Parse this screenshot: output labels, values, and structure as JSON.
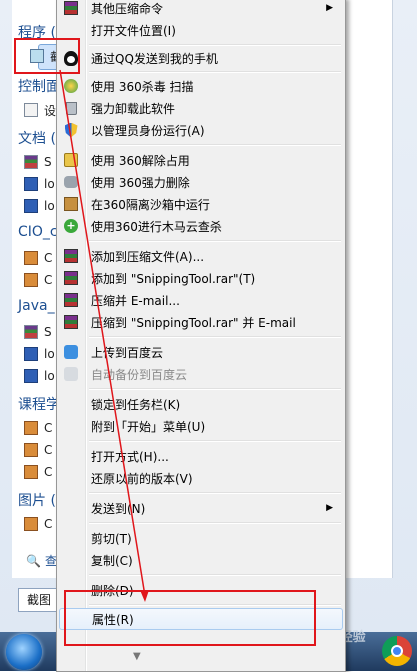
{
  "start_menu": {
    "groups": [
      {
        "label": "程序 ("
      },
      {
        "label": "控制面"
      },
      {
        "label": "文档 ("
      },
      {
        "label": "CIO_c"
      },
      {
        "label": "Java_"
      },
      {
        "label": "课程学"
      },
      {
        "label": "图片 ("
      }
    ],
    "items": {
      "program_1": "截",
      "control_1": "设",
      "doc_1": "S",
      "doc_2": "lo",
      "doc_3": "lo",
      "cio_1": "C",
      "cio_2": "C",
      "java_1": "S",
      "java_2": "lo",
      "java_3": "lo",
      "course_1": "C",
      "course_2": "C",
      "course_3": "C",
      "pic_1": "C"
    },
    "see_more": "查看",
    "search_value": "截图"
  },
  "context_menu": {
    "items": [
      {
        "label": "其他压缩命令",
        "submenu": true,
        "icon": "rar-icon"
      },
      {
        "label": "打开文件位置(I)"
      },
      {
        "label": "通过QQ发送到我的手机",
        "icon": "qq-icon"
      },
      {
        "label": "使用 360杀毒 扫描",
        "icon": "360-antivirus-icon"
      },
      {
        "label": "强力卸载此软件",
        "icon": "trash-icon"
      },
      {
        "label": "以管理员身份运行(A)",
        "icon": "uac-shield-icon"
      },
      {
        "label": "使用 360解除占用",
        "icon": "unlock-icon"
      },
      {
        "label": "使用 360强力删除",
        "icon": "shred-icon"
      },
      {
        "label": "在360隔离沙箱中运行",
        "icon": "sandbox-icon"
      },
      {
        "label": "使用360进行木马云查杀",
        "icon": "trojan-scan-icon"
      },
      {
        "label": "添加到压缩文件(A)...",
        "icon": "rar-icon"
      },
      {
        "label": "添加到 \"SnippingTool.rar\"(T)",
        "icon": "rar-icon"
      },
      {
        "label": "压缩并 E-mail...",
        "icon": "rar-icon"
      },
      {
        "label": "压缩到 \"SnippingTool.rar\" 并 E-mail",
        "icon": "rar-icon"
      },
      {
        "label": "上传到百度云",
        "icon": "baidu-cloud-icon"
      },
      {
        "label": "自动备份到百度云",
        "icon": "baidu-cloud-icon",
        "disabled": true
      },
      {
        "label": "锁定到任务栏(K)"
      },
      {
        "label": "附到「开始」菜单(U)"
      },
      {
        "label": "打开方式(H)..."
      },
      {
        "label": "还原以前的版本(V)"
      },
      {
        "label": "发送到(N)",
        "submenu": true
      },
      {
        "label": "剪切(T)"
      },
      {
        "label": "复制(C)"
      },
      {
        "label": "删除(D)"
      },
      {
        "label": "属性(R)",
        "highlighted": true
      }
    ]
  },
  "watermark": "Bai 经验",
  "colors": {
    "annotation_red": "#e0161b",
    "menu_bg": "#f0f0f0",
    "link_blue": "#1d4f91"
  }
}
